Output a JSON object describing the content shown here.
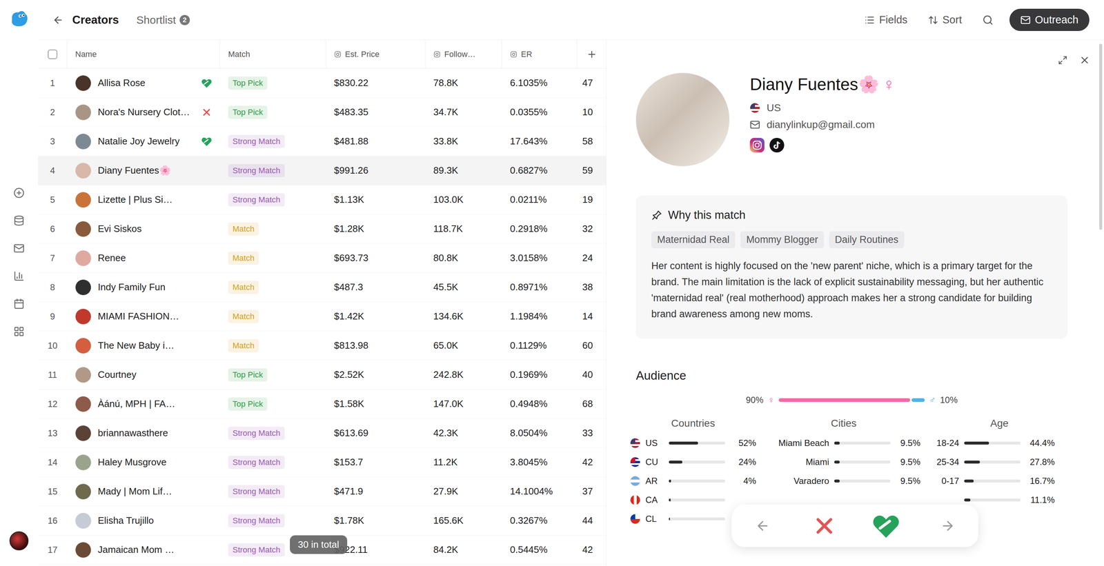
{
  "topbar": {
    "title": "Creators",
    "shortlist": {
      "label": "Shortlist",
      "count": "2"
    },
    "tools": [
      {
        "label": "Fields",
        "kind": "fields"
      },
      {
        "label": "Sort",
        "kind": "sort"
      }
    ],
    "outreach": "Outreach"
  },
  "table": {
    "columns": [
      {
        "key": "name",
        "label": "Name",
        "instagram": false
      },
      {
        "key": "match",
        "label": "Match",
        "instagram": false
      },
      {
        "key": "price",
        "label": "Est. Price",
        "instagram": true
      },
      {
        "key": "followers",
        "label": "Follow…",
        "instagram": true
      },
      {
        "key": "er",
        "label": "ER",
        "instagram": true
      }
    ],
    "rows": [
      {
        "index": "1",
        "name": "Allisa Rose",
        "status": "shortlisted",
        "match": {
          "label": "Top Pick",
          "color": "#2f9e44"
        },
        "price": "$830.22",
        "followers": "78.8K",
        "er": "6.1035%",
        "extra": "47",
        "selected": false,
        "avatar_color": "#4a3328"
      },
      {
        "index": "2",
        "name": "Nora's Nursery Clot…",
        "status": "rejected",
        "match": {
          "label": "Top Pick",
          "color": "#2f9e44"
        },
        "price": "$483.35",
        "followers": "34.7K",
        "er": "0.0355%",
        "extra": "10",
        "selected": false,
        "avatar_color": "#a89584"
      },
      {
        "index": "3",
        "name": "Natalie Joy Jewelry",
        "status": "shortlisted",
        "match": {
          "label": "Strong Match",
          "color": "#9b59b6"
        },
        "price": "$481.88",
        "followers": "33.8K",
        "er": "17.643%",
        "extra": "58",
        "selected": false,
        "avatar_color": "#7c8a94"
      },
      {
        "index": "4",
        "name": "Diany Fuentes🌸",
        "status": "none",
        "match": {
          "label": "Strong Match",
          "color": "#9b59b6"
        },
        "price": "$991.26",
        "followers": "89.3K",
        "er": "0.6827%",
        "extra": "59",
        "selected": true,
        "avatar_color": "#d9b8a8"
      },
      {
        "index": "5",
        "name": "Lizette | Plus Si…",
        "status": "none",
        "match": {
          "label": "Strong Match",
          "color": "#9b59b6"
        },
        "price": "$1.13K",
        "followers": "103.0K",
        "er": "0.0211%",
        "extra": "19",
        "selected": false,
        "avatar_color": "#c9733a"
      },
      {
        "index": "6",
        "name": "Evi Siskos",
        "status": "none",
        "match": {
          "label": "Match",
          "color": "#d4a017"
        },
        "price": "$1.28K",
        "followers": "118.7K",
        "er": "0.2918%",
        "extra": "32",
        "selected": false,
        "avatar_color": "#8a5a3c"
      },
      {
        "index": "7",
        "name": "Renee",
        "status": "none",
        "match": {
          "label": "Match",
          "color": "#d4a017"
        },
        "price": "$693.73",
        "followers": "80.8K",
        "er": "3.0158%",
        "extra": "24",
        "selected": false,
        "avatar_color": "#e0a9a0"
      },
      {
        "index": "8",
        "name": "Indy Family Fun",
        "status": "none",
        "match": {
          "label": "Match",
          "color": "#d4a017"
        },
        "price": "$487.3",
        "followers": "45.5K",
        "er": "0.8971%",
        "extra": "38",
        "selected": false,
        "avatar_color": "#2f2f2f"
      },
      {
        "index": "9",
        "name": "MIAMI FASHION…",
        "status": "none",
        "match": {
          "label": "Match",
          "color": "#d4a017"
        },
        "price": "$1.42K",
        "followers": "134.6K",
        "er": "1.1984%",
        "extra": "14",
        "selected": false,
        "avatar_color": "#c0392b"
      },
      {
        "index": "10",
        "name": "The New Baby i…",
        "status": "none",
        "match": {
          "label": "Match",
          "color": "#d4a017"
        },
        "price": "$813.98",
        "followers": "65.0K",
        "er": "0.1129%",
        "extra": "60",
        "selected": false,
        "avatar_color": "#d35f3f"
      },
      {
        "index": "11",
        "name": "Courtney",
        "status": "none",
        "match": {
          "label": "Top Pick",
          "color": "#2f9e44"
        },
        "price": "$2.52K",
        "followers": "242.8K",
        "er": "0.1969%",
        "extra": "40",
        "selected": false,
        "avatar_color": "#b09a86"
      },
      {
        "index": "12",
        "name": "Àánú, MPH | FA…",
        "status": "none",
        "match": {
          "label": "Top Pick",
          "color": "#2f9e44"
        },
        "price": "$1.58K",
        "followers": "147.0K",
        "er": "0.4948%",
        "extra": "68",
        "selected": false,
        "avatar_color": "#8e5a4a"
      },
      {
        "index": "13",
        "name": "briannawasthere",
        "status": "none",
        "match": {
          "label": "Strong Match",
          "color": "#9b59b6"
        },
        "price": "$613.69",
        "followers": "42.3K",
        "er": "8.0504%",
        "extra": "33",
        "selected": false,
        "avatar_color": "#5b4236"
      },
      {
        "index": "14",
        "name": "Haley Musgrove",
        "status": "none",
        "match": {
          "label": "Strong Match",
          "color": "#9b59b6"
        },
        "price": "$153.7",
        "followers": "11.2K",
        "er": "3.8045%",
        "extra": "42",
        "selected": false,
        "avatar_color": "#9aa48c"
      },
      {
        "index": "15",
        "name": "Mady | Mom Lif…",
        "status": "none",
        "match": {
          "label": "Strong Match",
          "color": "#9b59b6"
        },
        "price": "$471.9",
        "followers": "27.9K",
        "er": "14.1004%",
        "extra": "37",
        "selected": false,
        "avatar_color": "#6e6a4e"
      },
      {
        "index": "16",
        "name": "Elisha Trujillo",
        "status": "none",
        "match": {
          "label": "Strong Match",
          "color": "#9b59b6"
        },
        "price": "$1.78K",
        "followers": "165.6K",
        "er": "0.3267%",
        "extra": "44",
        "selected": false,
        "avatar_color": "#c6ccd6"
      },
      {
        "index": "17",
        "name": "Jamaican Mom …",
        "status": "none",
        "match": {
          "label": "Strong Match",
          "color": "#9b59b6"
        },
        "price": "$922.11",
        "followers": "84.2K",
        "er": "0.5445%",
        "extra": "42",
        "selected": false,
        "avatar_color": "#6b4a36"
      }
    ],
    "total": "30 in total"
  },
  "detail": {
    "name": "Diany Fuentes🌸",
    "gender": "♀",
    "country": {
      "label": "US",
      "flag": {
        "stripes": [
          "#b22234",
          "#ffffff",
          "#b22234",
          "#ffffff",
          "#b22234"
        ],
        "canton": "#3c3b6e",
        "vertical": false
      }
    },
    "email": "dianylinkup@gmail.com",
    "why": {
      "title": "Why this match",
      "tags": [
        "Maternidad Real",
        "Mommy Blogger",
        "Daily Routines"
      ],
      "text": "Her content is highly focused on the 'new parent' niche, which is a primary target for the brand. The main limitation is the lack of explicit sustainability messaging, but her authentic 'maternidad real' (real motherhood) approach makes her a strong candidate for building brand awareness among new moms."
    },
    "audience": {
      "title": "Audience",
      "female": {
        "reading": "90%",
        "symbol": "♀",
        "level": 0.9,
        "color": "#f06aa8"
      },
      "male": {
        "reading": "10%",
        "symbol": "♂",
        "level": 0.1,
        "color": "#4fb3e8"
      },
      "groups": [
        {
          "title": "Countries",
          "kind": "country",
          "items": [
            {
              "label": "US",
              "reading": "52%",
              "level": 0.52,
              "flag": {
                "stripes": [
                  "#b22234",
                  "#ffffff",
                  "#b22234",
                  "#ffffff",
                  "#b22234"
                ],
                "canton": "#3c3b6e",
                "vertical": false
              }
            },
            {
              "label": "CU",
              "reading": "24%",
              "level": 0.24,
              "flag": {
                "stripes": [
                  "#002a8f",
                  "#ffffff",
                  "#002a8f",
                  "#ffffff",
                  "#002a8f"
                ],
                "canton": "#cf142b",
                "vertical": false
              }
            },
            {
              "label": "AR",
              "reading": "4%",
              "level": 0.04,
              "flag": {
                "stripes": [
                  "#74acdf",
                  "#ffffff",
                  "#74acdf"
                ],
                "canton": "",
                "vertical": false
              }
            },
            {
              "label": "CA",
              "reading": "",
              "level": 0.03,
              "flag": {
                "stripes": [
                  "#d52b1e",
                  "#ffffff",
                  "#d52b1e"
                ],
                "canton": "",
                "vertical": true
              }
            },
            {
              "label": "CL",
              "reading": "",
              "level": 0.02,
              "flag": {
                "stripes": [
                  "#ffffff",
                  "#d52b1e"
                ],
                "canton": "#0039a6",
                "vertical": false
              }
            }
          ]
        },
        {
          "title": "Cities",
          "kind": "city",
          "items": [
            {
              "label": "Miami Beach",
              "reading": "9.5%",
              "level": 0.095
            },
            {
              "label": "Miami",
              "reading": "9.5%",
              "level": 0.095
            },
            {
              "label": "Varadero",
              "reading": "9.5%",
              "level": 0.095
            }
          ]
        },
        {
          "title": "Age",
          "kind": "age",
          "items": [
            {
              "label": "18-24",
              "reading": "44.4%",
              "level": 0.444
            },
            {
              "label": "25-34",
              "reading": "27.8%",
              "level": 0.278
            },
            {
              "label": "0-17",
              "reading": "16.7%",
              "level": 0.167
            },
            {
              "label": "",
              "reading": "11.1%",
              "level": 0.111
            }
          ]
        }
      ]
    }
  }
}
